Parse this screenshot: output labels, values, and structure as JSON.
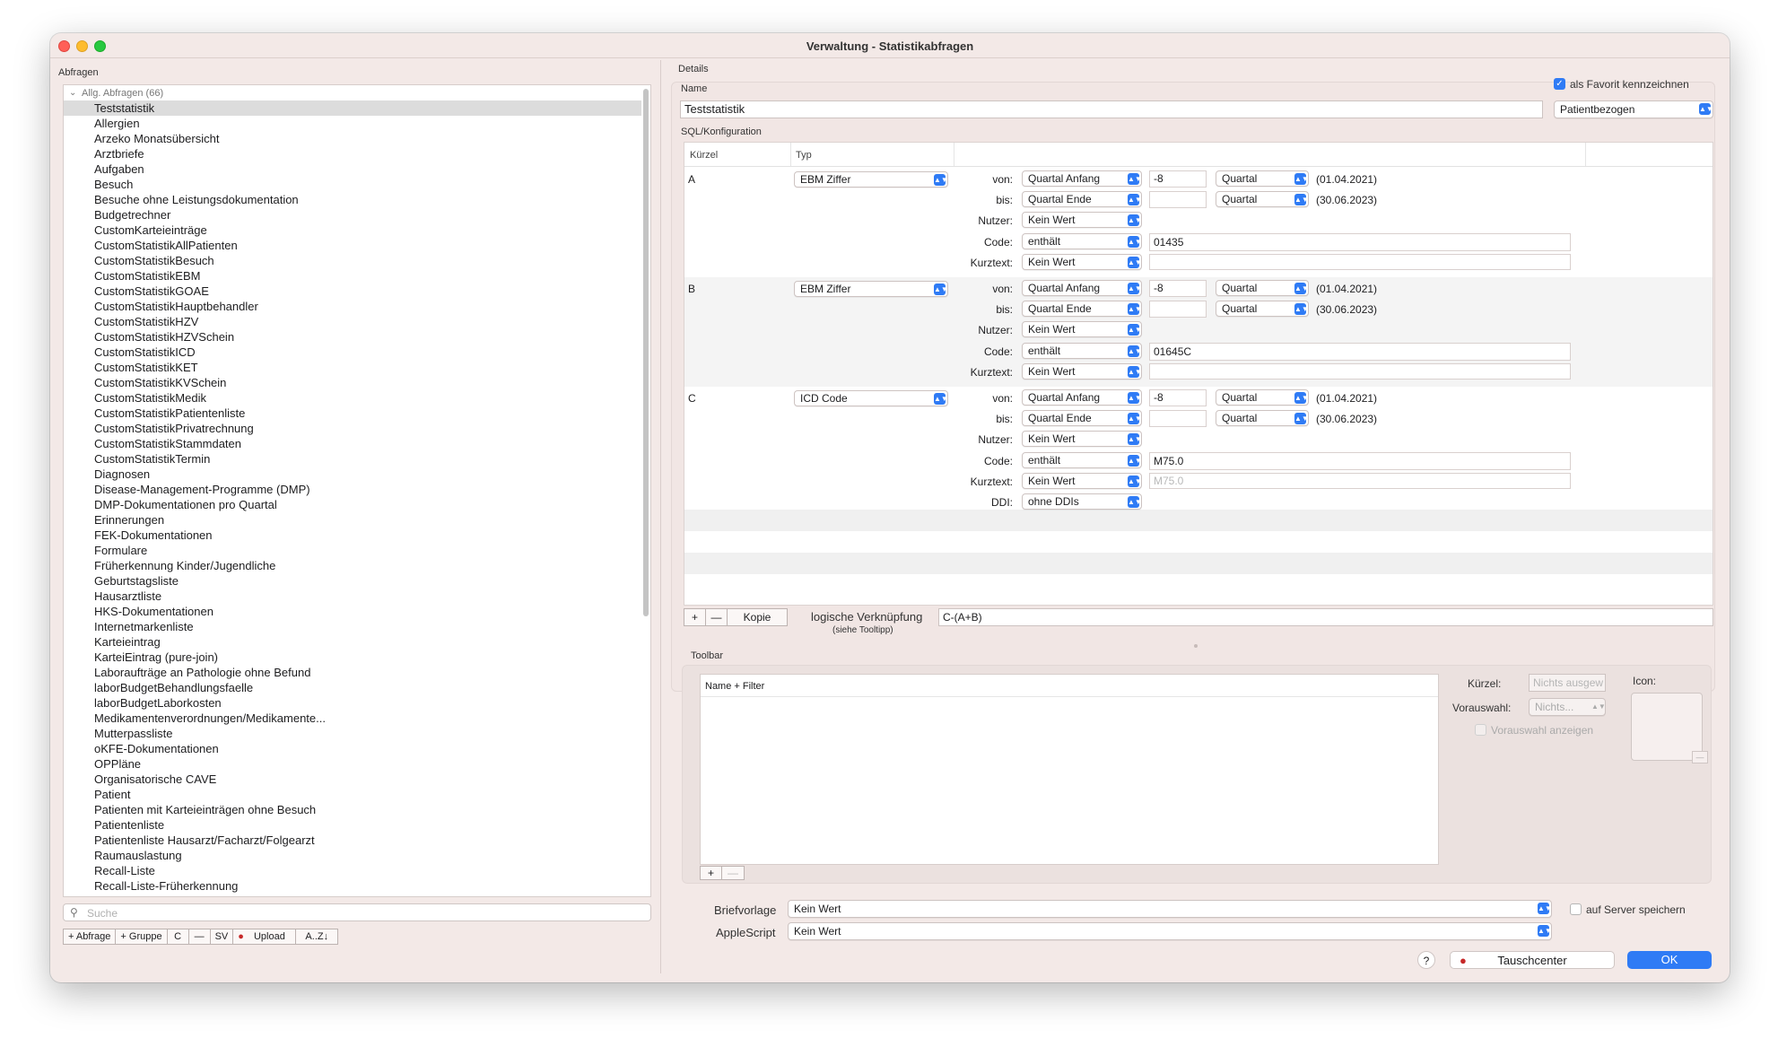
{
  "window": {
    "title": "Verwaltung - Statistikabfragen"
  },
  "left": {
    "section_label": "Abfragen",
    "group": "Allg. Abfragen (66)",
    "items": [
      "Teststatistik",
      "Allergien",
      "Arzeko Monatsübersicht",
      "Arztbriefe",
      "Aufgaben",
      "Besuch",
      "Besuche ohne Leistungsdokumentation",
      "Budgetrechner",
      "CustomKarteieinträge",
      "CustomStatistikAllPatienten",
      "CustomStatistikBesuch",
      "CustomStatistikEBM",
      "CustomStatistikGOAE",
      "CustomStatistikHauptbehandler",
      "CustomStatistikHZV",
      "CustomStatistikHZVSchein",
      "CustomStatistikICD",
      "CustomStatistikKET",
      "CustomStatistikKVSchein",
      "CustomStatistikMedik",
      "CustomStatistikPatientenliste",
      "CustomStatistikPrivatrechnung",
      "CustomStatistikStammdaten",
      "CustomStatistikTermin",
      "Diagnosen",
      "Disease-Management-Programme (DMP)",
      "DMP-Dokumentationen pro Quartal",
      "Erinnerungen",
      "FEK-Dokumentationen",
      "Formulare",
      "Früherkennung Kinder/Jugendliche",
      "Geburtstagsliste",
      "Hausarztliste",
      "HKS-Dokumentationen",
      "Internetmarkenliste",
      "Karteieintrag",
      "KarteiEintrag (pure-join)",
      "Laboraufträge an Pathologie ohne Befund",
      "laborBudgetBehandlungsfaelle",
      "laborBudgetLaborkosten",
      "Medikamentenverordnungen/Medikamente...",
      "Mutterpassliste",
      "oKFE-Dokumentationen",
      "OPPläne",
      "Organisatorische CAVE",
      "Patient",
      "Patienten mit Karteieinträgen ohne Besuch",
      "Patientenliste",
      "Patientenliste Hausarzt/Facharzt/Folgearzt",
      "Raumauslastung",
      "Recall-Liste",
      "Recall-Liste-Früherkennung"
    ],
    "search_placeholder": "Suche",
    "buttons": [
      "+ Abfrage",
      "+ Gruppe",
      "C",
      "—",
      "SV",
      "Upload",
      "A..Z↓"
    ]
  },
  "details": {
    "section_label": "Details",
    "name_label": "Name",
    "name_value": "Teststatistik",
    "favorite_label": "als Favorit kennzeichnen",
    "scope_popup": "Patientbezogen",
    "sql_label": "SQL/Konfiguration",
    "col_kuerzel": "Kürzel",
    "col_typ": "Typ",
    "labels": {
      "von": "von:",
      "bis": "bis:",
      "nutzer": "Nutzer:",
      "code": "Code:",
      "kurztext": "Kurztext:",
      "ddi": "DDI:"
    },
    "rows": [
      {
        "key": "A",
        "typ": "EBM Ziffer",
        "von": "Quartal Anfang",
        "von_val": "-8",
        "von_unit": "Quartal",
        "von_date": "(01.04.2021)",
        "bis": "Quartal Ende",
        "bis_unit": "Quartal",
        "bis_date": "(30.06.2023)",
        "nutzer": "Kein Wert",
        "code_op": "enthält",
        "code_val": "01435",
        "kurztext": "Kein Wert",
        "kurztext_val": ""
      },
      {
        "key": "B",
        "typ": "EBM Ziffer",
        "von": "Quartal Anfang",
        "von_val": "-8",
        "von_unit": "Quartal",
        "von_date": "(01.04.2021)",
        "bis": "Quartal Ende",
        "bis_unit": "Quartal",
        "bis_date": "(30.06.2023)",
        "nutzer": "Kein Wert",
        "code_op": "enthält",
        "code_val": "01645C",
        "kurztext": "Kein Wert",
        "kurztext_val": ""
      },
      {
        "key": "C",
        "typ": "ICD Code",
        "von": "Quartal Anfang",
        "von_val": "-8",
        "von_unit": "Quartal",
        "von_date": "(01.04.2021)",
        "bis": "Quartal Ende",
        "bis_unit": "Quartal",
        "bis_date": "(30.06.2023)",
        "nutzer": "Kein Wert",
        "code_op": "enthält",
        "code_val": "M75.0",
        "kurztext": "Kein Wert",
        "kurztext_val": "M75.0",
        "ddi": "ohne DDIs"
      }
    ],
    "table_buttons": {
      "add": "+",
      "remove": "—",
      "copy": "Kopie"
    },
    "logic_label": "logische Verknüpfung",
    "logic_hint": "(siehe Tooltipp)",
    "logic_value": "C-(A+B)"
  },
  "toolbar": {
    "section_label": "Toolbar",
    "list_header": "Name + Filter",
    "kuerzel_label": "Kürzel:",
    "kuerzel_placeholder": "Nichts ausgew",
    "vorauswahl_label": "Vorauswahl:",
    "vorauswahl_value": "Nichts...",
    "vorauswahl_show": "Vorauswahl anzeigen",
    "icon_label": "Icon:",
    "add": "+",
    "remove": "—",
    "icon_minus": "—"
  },
  "bottom": {
    "briefvorlage_label": "Briefvorlage",
    "briefvorlage_value": "Kein Wert",
    "applescript_label": "AppleScript",
    "applescript_value": "Kein Wert",
    "server_label": "auf Server speichern",
    "help": "?",
    "tauschcenter": "Tauschcenter",
    "ok": "OK"
  },
  "colors": {
    "accent": "#2f7bf5",
    "window_bg": "#f3e9e7"
  }
}
